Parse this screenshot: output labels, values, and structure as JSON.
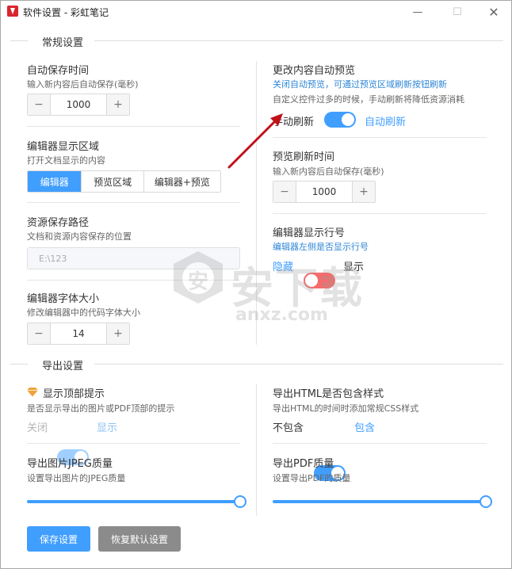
{
  "window": {
    "title": "软件设置 - 彩虹笔记",
    "min_glyph": "—",
    "max_glyph": "☐",
    "close_glyph": "✕"
  },
  "colors": {
    "accent": "#409eff",
    "danger": "#f56c6c",
    "disabled": "#a0cfff"
  },
  "general": {
    "title": "常规设置",
    "autosave": {
      "label": "自动保存时间",
      "desc": "输入新内容后自动保存(毫秒)",
      "value": "1000",
      "minus": "−",
      "plus": "+"
    },
    "editor_area": {
      "label": "编辑器显示区域",
      "desc": "打开文档显示的内容",
      "options": [
        "编辑器",
        "预览区域",
        "编辑器+预览"
      ],
      "selected": "编辑器"
    },
    "resource_path": {
      "label": "资源保存路径",
      "desc": "文档和资源内容保存的位置",
      "value": "E:\\123"
    },
    "font_size": {
      "label": "编辑器字体大小",
      "desc": "修改编辑器中的代码字体大小",
      "value": "14",
      "minus": "−",
      "plus": "+"
    },
    "auto_preview": {
      "label": "更改内容自动预览",
      "hint": "关闭自动预览，可通过预览区域刷新按钮刷新",
      "desc": "自定义控件过多的时候，手动刷新将降低资源消耗",
      "off_label": "手动刷新",
      "on_label": "自动刷新",
      "on": true
    },
    "preview_refresh": {
      "label": "预览刷新时间",
      "desc": "输入新内容后自动保存(毫秒)",
      "value": "1000",
      "minus": "−",
      "plus": "+"
    },
    "line_numbers": {
      "label": "编辑器显示行号",
      "hint": "编辑器左侧是否显示行号",
      "off_label": "隐藏",
      "on_label": "显示",
      "on": false
    }
  },
  "export": {
    "title": "导出设置",
    "top_hint": {
      "label": "显示顶部提示",
      "icon": "diamond-icon",
      "desc": "是否显示导出的图片或PDF顶部的提示",
      "off_label": "关闭",
      "on_label": "显示",
      "on": true,
      "disabled": true
    },
    "html_style": {
      "label": "导出HTML是否包含样式",
      "desc": "导出HTML的时间时添加常规CSS样式",
      "off_label": "不包含",
      "on_label": "包含",
      "on": true
    },
    "jpeg_quality": {
      "label": "导出图片JPEG质量",
      "desc": "设置导出图片的JPEG质量",
      "value": 100
    },
    "pdf_quality": {
      "label": "导出PDF质量",
      "desc": "设置导出PDF的质量",
      "value": 100
    }
  },
  "buttons": {
    "save": "保存设置",
    "reset": "恢复默认设置"
  },
  "watermark": {
    "main": "安下载",
    "sub": "anxz.com",
    "badge": "安"
  }
}
